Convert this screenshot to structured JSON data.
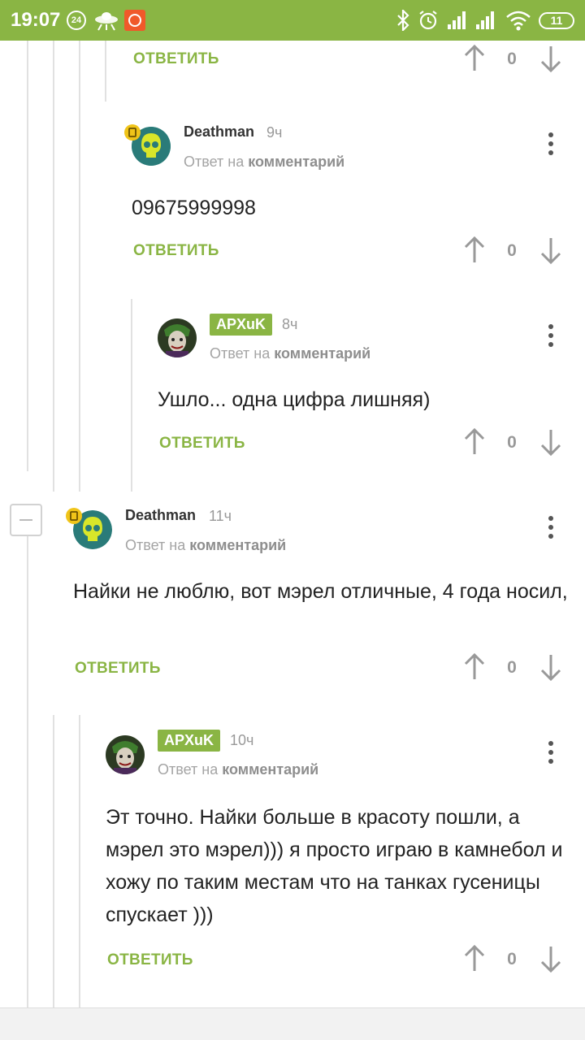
{
  "status_bar": {
    "time": "19:07",
    "notification_count": "24",
    "battery": "11"
  },
  "comments": [
    {
      "reply_label": "ОТВЕТИТЬ",
      "score": "0"
    },
    {
      "author": "Deathman",
      "time": "9ч",
      "reply_to_prefix": "Ответ на",
      "reply_to_link": "комментарий",
      "text": "09675999998",
      "reply_label": "ОТВЕТИТЬ",
      "score": "0"
    },
    {
      "author": "APXuK",
      "time": "8ч",
      "reply_to_prefix": "Ответ на",
      "reply_to_link": "комментарий",
      "text": "Ушло... одна цифра лишняя)",
      "reply_label": "ОТВЕТИТЬ",
      "score": "0"
    },
    {
      "author": "Deathman",
      "time": "11ч",
      "reply_to_prefix": "Ответ на",
      "reply_to_link": "комментарий",
      "text": "Найки не люблю, вот мэрел отличные, 4 года носил,",
      "reply_label": "ОТВЕТИТЬ",
      "score": "0"
    },
    {
      "author": "APXuK",
      "time": "10ч",
      "reply_to_prefix": "Ответ на",
      "reply_to_link": "комментарий",
      "text": "Эт точно. Найки больше в красоту пошли, а мэрел это мэрел))) я просто играю в камнебол и хожу по таким местам что на танках гусеницы спускает )))",
      "reply_label": "ОТВЕТИТЬ",
      "score": "0"
    }
  ],
  "colors": {
    "accent": "#8ab544",
    "text": "#222222",
    "muted": "#999999"
  }
}
